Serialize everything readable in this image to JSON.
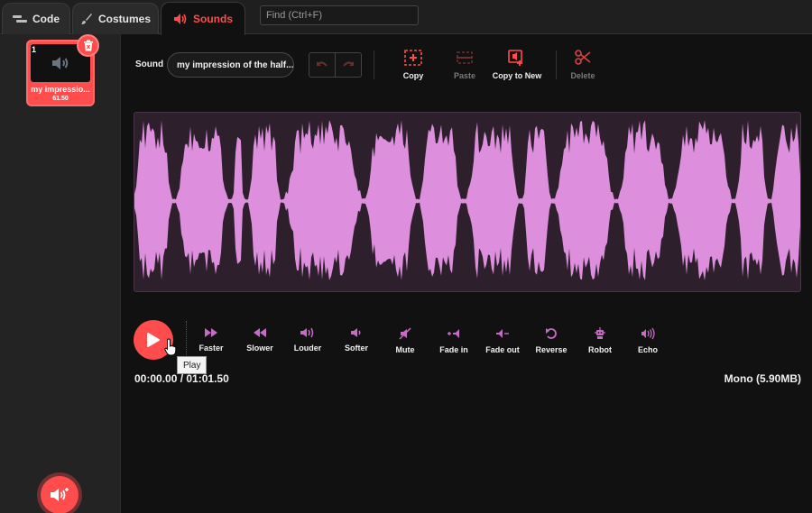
{
  "tabs": [
    {
      "label": "Code",
      "icon": "code-icon"
    },
    {
      "label": "Costumes",
      "icon": "brush-icon"
    },
    {
      "label": "Sounds",
      "icon": "speaker-icon",
      "active": true
    }
  ],
  "search": {
    "placeholder": "Find (Ctrl+F)"
  },
  "sidebar": {
    "sound_list": [
      {
        "index": "1",
        "name": "my impressio...",
        "duration": "61.50",
        "selected": true
      }
    ]
  },
  "editor": {
    "sound_label": "Sound",
    "sound_name": "my impression of the half...",
    "tools": {
      "copy": "Copy",
      "paste": "Paste",
      "copy_to_new": "Copy to New",
      "delete": "Delete"
    },
    "effects": [
      "Faster",
      "Slower",
      "Louder",
      "Softer",
      "Mute",
      "Fade in",
      "Fade out",
      "Reverse",
      "Robot",
      "Echo"
    ],
    "tooltip": "Play",
    "time": "00:00.00 / 01:01.50",
    "format": "Mono (5.90MB)"
  },
  "colors": {
    "accent": "#ff4c4c",
    "waveform": "#dd8fdd",
    "effect_icon": "#c86bc8",
    "background": "#111111"
  }
}
